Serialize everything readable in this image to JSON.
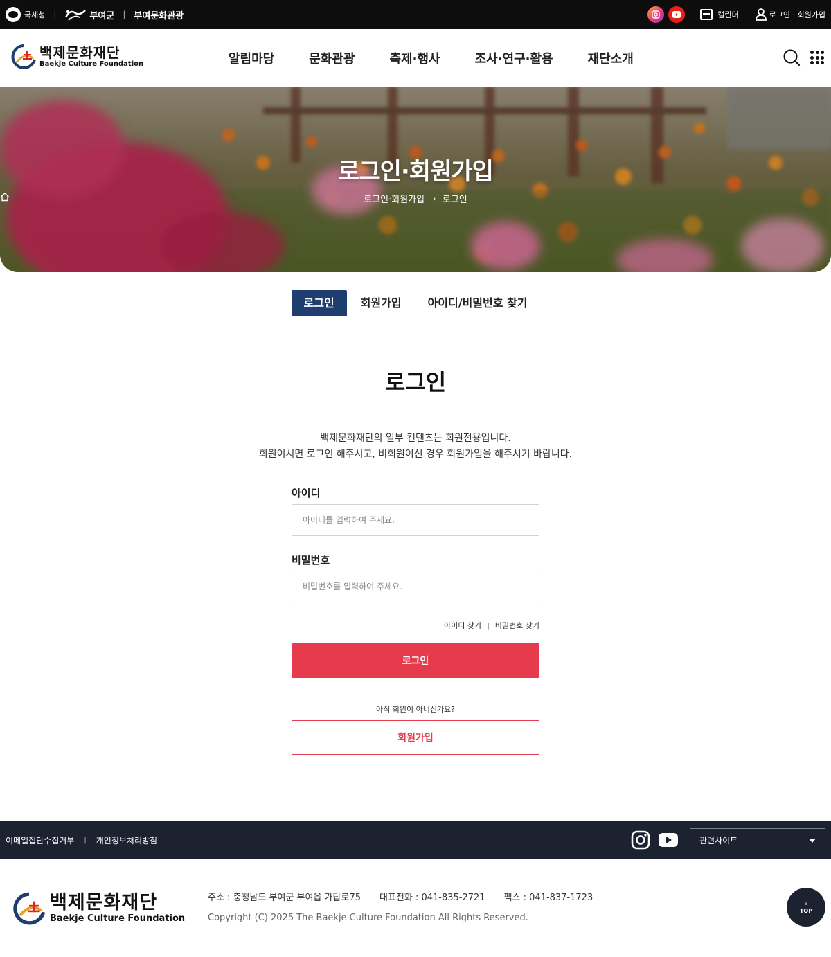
{
  "topbar": {
    "gov_label": "국세청",
    "county_label": "부여군",
    "tourism_label": "부여문화관광",
    "calendar_label": "캘린더",
    "login_join_label": "로그인 · 회원가입"
  },
  "header": {
    "logo_kr": "백제문화재단",
    "logo_en": "Baekje Culture Foundation",
    "nav": [
      "알림마당",
      "문화관광",
      "축제·행사",
      "조사·연구·활용",
      "재단소개"
    ]
  },
  "hero": {
    "title": "로그인·회원가입",
    "breadcrumb": [
      "로그인·회원가입",
      "로그인"
    ]
  },
  "tabs": [
    {
      "label": "로그인",
      "active": true
    },
    {
      "label": "회원가입",
      "active": false
    },
    {
      "label": "아이디/비밀번호 찾기",
      "active": false
    }
  ],
  "login": {
    "title": "로그인",
    "intro_line1": "백제문화재단의 일부 컨텐츠는 회원전용입니다.",
    "intro_line2": "회원이시면 로그인 해주시고, 비회원이신 경우 회원가입을 해주시기 바랍니다.",
    "id_label": "아이디",
    "id_value": "",
    "id_placeholder": "아이디를 입력하여 주세요.",
    "pw_label": "비밀번호",
    "pw_value": "",
    "pw_placeholder": "비밀번호를 입력하여 주세요.",
    "find_id": "아이디 찾기",
    "find_pw": "비밀번호 찾기",
    "login_button": "로그인",
    "not_member": "아직 회원이 아니신가요?",
    "join_button": "회원가입"
  },
  "footer": {
    "link_email": "이메일집단수집거부",
    "link_privacy": "개인정보처리방침",
    "related_sites": "관련사이트",
    "logo_kr": "백제문화재단",
    "logo_en": "Baekje Culture Foundation",
    "address": "주소 : 충청남도 부여군 부여읍 가탑로75",
    "phone": "대표전화 : 041-835-2721",
    "fax": "팩스 : 041-837-1723",
    "copyright": "Copyright (C) 2025 The Baekje Culture Foundation All Rights Reserved.",
    "top_label": "TOP"
  },
  "colors": {
    "brand_navy": "#1f3d6e",
    "accent_red": "#e63a4d",
    "footer_dark": "#1c2230"
  },
  "icons": [
    "instagram-icon",
    "youtube-icon",
    "calendar-icon",
    "user-icon",
    "search-icon",
    "all-menu-icon",
    "home-icon",
    "chevron-right-icon",
    "caret-down-icon",
    "arrow-up-icon"
  ]
}
